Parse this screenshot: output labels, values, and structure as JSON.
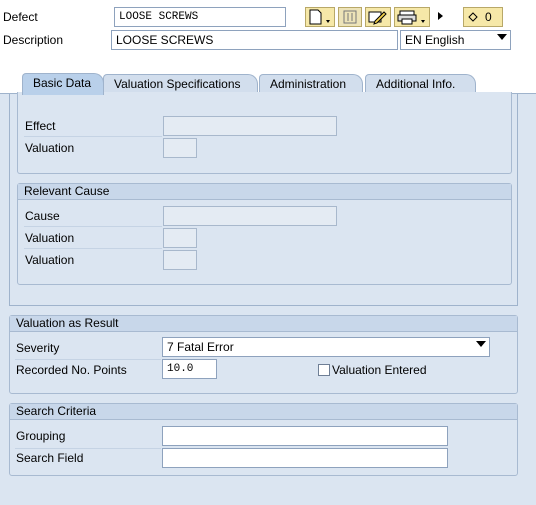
{
  "header": {
    "defect_label": "Defect",
    "defect_value": "LOOSE SCREWS",
    "description_label": "Description",
    "description_value": "LOOSE SCREWS",
    "language_value": "EN English",
    "counter_value": "0"
  },
  "toolbar": {
    "icons": [
      "new-document-icon",
      "attachment-icon",
      "edit-note-icon",
      "print-icon",
      "more-arrow-icon",
      "counter-icon"
    ]
  },
  "tabs": [
    {
      "label": "Basic Data",
      "active": true
    },
    {
      "label": "Valuation Specifications",
      "active": false
    },
    {
      "label": "Administration",
      "active": false
    },
    {
      "label": "Additional Info.",
      "active": false
    }
  ],
  "effect_section": {
    "effect_label": "Effect",
    "valuation_label": "Valuation"
  },
  "relevant_cause": {
    "title": "Relevant Cause",
    "cause_label": "Cause",
    "valuation1_label": "Valuation",
    "valuation2_label": "Valuation"
  },
  "valuation_result": {
    "title": "Valuation as Result",
    "severity_label": "Severity",
    "severity_value": "7 Fatal Error",
    "points_label": "Recorded No. Points",
    "points_value": "10.0",
    "entered_label": "Valuation Entered",
    "entered_checked": false
  },
  "search_criteria": {
    "title": "Search Criteria",
    "grouping_label": "Grouping",
    "grouping_value": "",
    "search_field_label": "Search Field",
    "search_field_value": ""
  },
  "colors": {
    "toolbar_button": "#f6e8a8",
    "panel_bg": "#dbe5f1",
    "active_tab": "#b9d0ea"
  }
}
